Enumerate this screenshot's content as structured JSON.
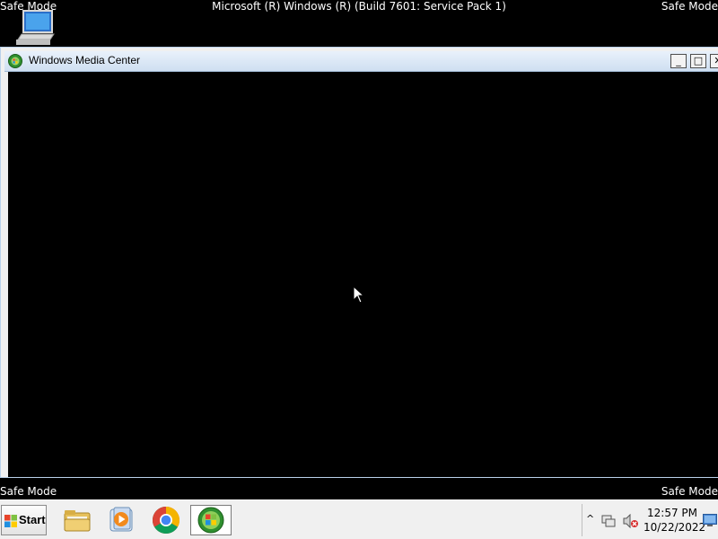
{
  "desktop": {
    "watermark_top_left": "Safe Mode",
    "watermark_top_right": "Safe Mode",
    "watermark_top_center": "Microsoft (R) Windows (R) (Build 7601: Service Pack 1)",
    "watermark_bottom_left": "Safe Mode",
    "watermark_bottom_right": "Safe Mode",
    "icon": "computer-icon"
  },
  "window": {
    "title": "Windows Media Center",
    "icon": "windows-media-center-icon",
    "minimize_label": "_",
    "maximize_label": "□",
    "close_label": "✕",
    "client_background": "#000000"
  },
  "taskbar": {
    "start_label": "Start",
    "pinned": [
      {
        "name": "windows-explorer",
        "icon": "folder-icon"
      },
      {
        "name": "windows-media-player",
        "icon": "media-player-icon"
      },
      {
        "name": "google-chrome",
        "icon": "chrome-icon"
      },
      {
        "name": "windows-media-center",
        "icon": "windows-media-center-icon",
        "active": true
      }
    ],
    "tray": {
      "chevron": "^",
      "time": "12:57 PM",
      "date": "10/22/2022"
    }
  },
  "colors": {
    "taskbar_bg": "#f0f0f0",
    "titlebar_bg": "#cfdff1",
    "watermark": "#ffffff"
  }
}
